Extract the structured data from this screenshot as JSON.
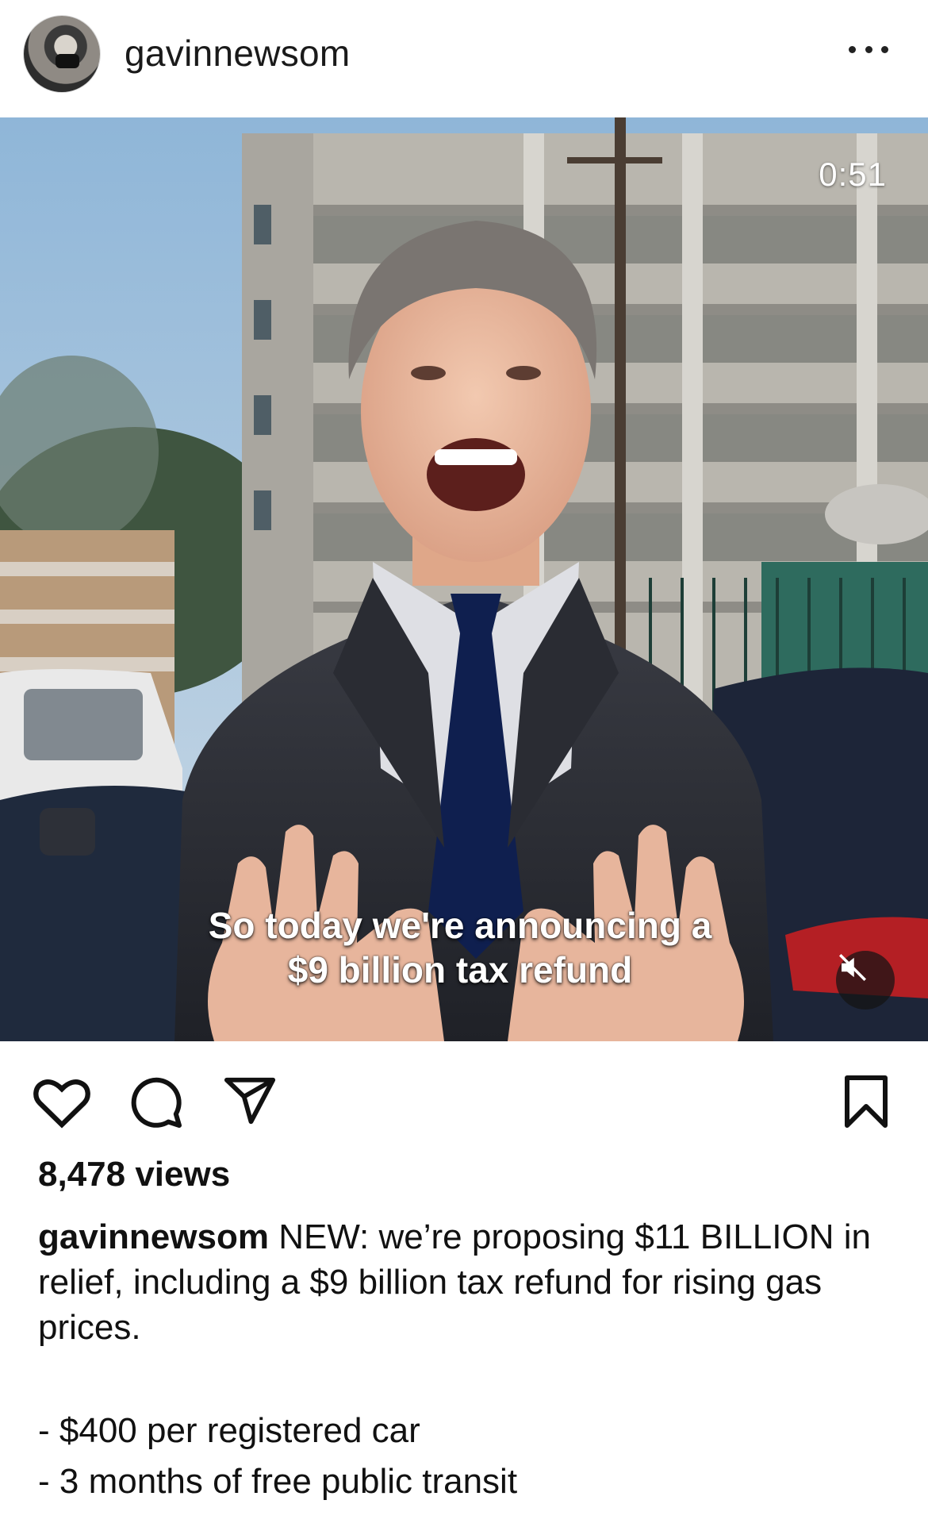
{
  "header": {
    "username": "gavinnewsom",
    "more_icon": "more-horizontal-icon"
  },
  "media": {
    "timer": "0:51",
    "caption_line1": "So today we're announcing a",
    "caption_line2": "$9 billion tax refund",
    "mute_icon": "muted-speaker-icon"
  },
  "actions": {
    "like_icon": "heart-icon",
    "comment_icon": "comment-icon",
    "share_icon": "paper-plane-icon",
    "save_icon": "bookmark-icon"
  },
  "stats": {
    "views": "8,478 views"
  },
  "post": {
    "author": "gavinnewsom",
    "text": "NEW: we’re proposing $11 BILLION in relief, including a $9 billion tax refund for rising gas prices.",
    "bullets": [
      "- $400 per registered car",
      "- 3 months of free public transit"
    ]
  }
}
